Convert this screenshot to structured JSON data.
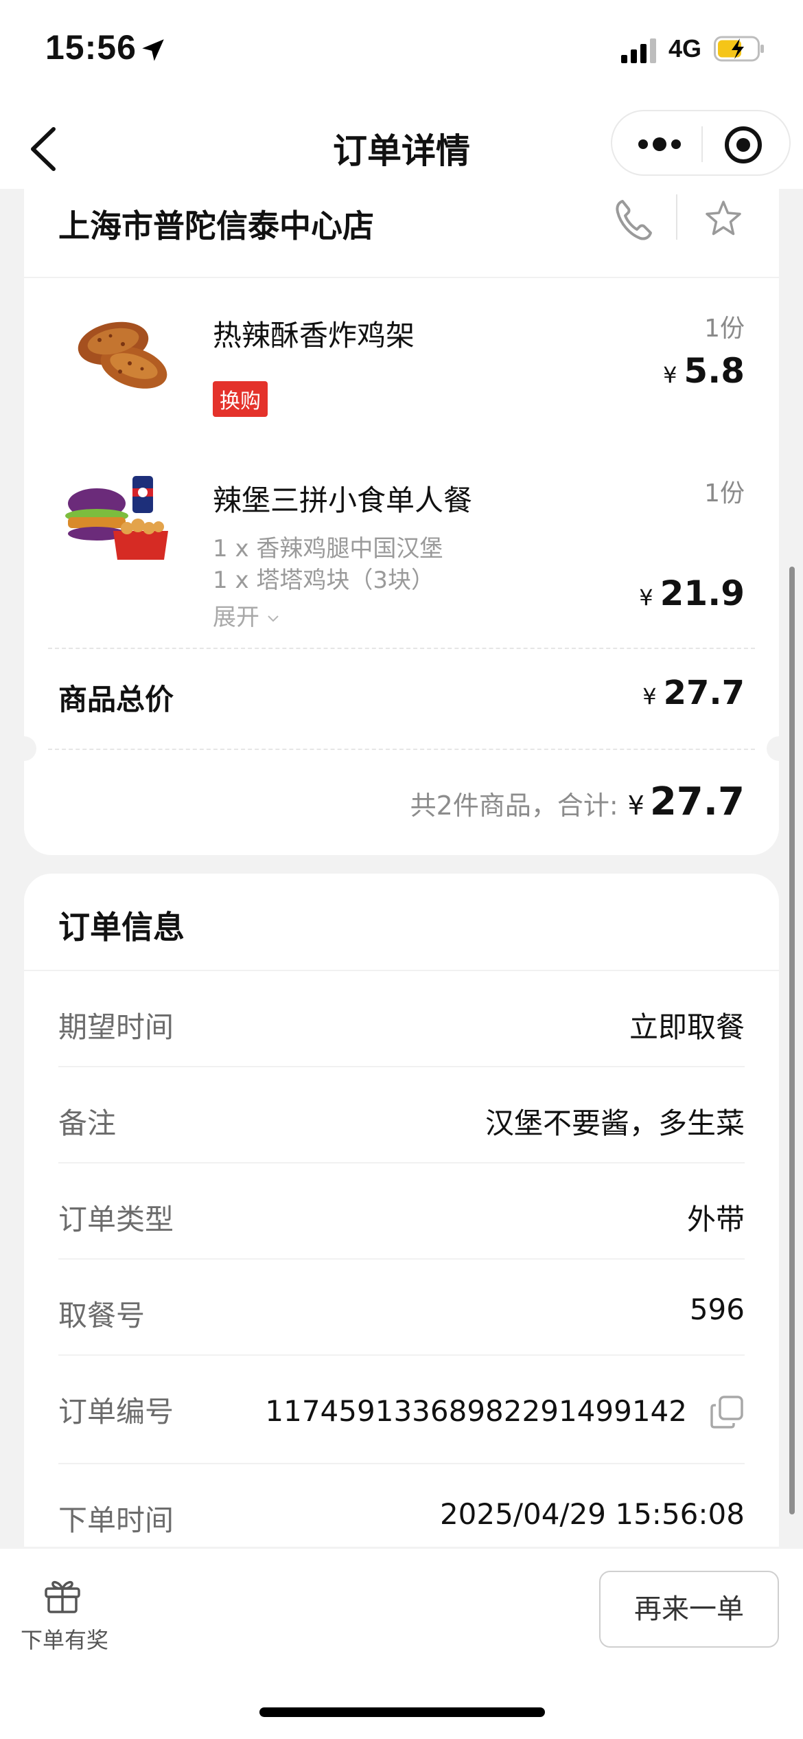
{
  "status_bar": {
    "time": "15:56",
    "network": "4G"
  },
  "nav": {
    "title": "订单详情"
  },
  "store": {
    "name": "上海市普陀信泰中心店"
  },
  "items": [
    {
      "name": "热辣酥香炸鸡架",
      "qty": "1份",
      "currency": "¥",
      "price": "5.8",
      "tag": "换购"
    },
    {
      "name": "辣堡三拼小食单人餐",
      "qty": "1份",
      "currency": "¥",
      "price": "21.9",
      "sub_items": [
        "1 x 香辣鸡腿中国汉堡",
        "1 x 塔塔鸡块（3块）"
      ],
      "expand_label": "展开"
    }
  ],
  "totals": {
    "goods_total_label": "商品总价",
    "currency": "¥",
    "goods_total": "27.7",
    "summary_label": "共2件商品，合计:",
    "summary_total": "27.7"
  },
  "order_info": {
    "title": "订单信息",
    "rows": [
      {
        "label": "期望时间",
        "value": "立即取餐"
      },
      {
        "label": "备注",
        "value": "汉堡不要酱，多生菜"
      },
      {
        "label": "订单类型",
        "value": "外带"
      },
      {
        "label": "取餐号",
        "value": "596"
      },
      {
        "label": "订单编号",
        "value": "1174591336898229149914‌2"
      },
      {
        "label": "下单时间",
        "value": "2025/04/29 15:56:08"
      }
    ]
  },
  "bottom": {
    "reward_label": "下单有奖",
    "reorder_label": "再来一单"
  },
  "colors": {
    "tag_red": "#e4322b",
    "background": "#f2f2f2"
  }
}
